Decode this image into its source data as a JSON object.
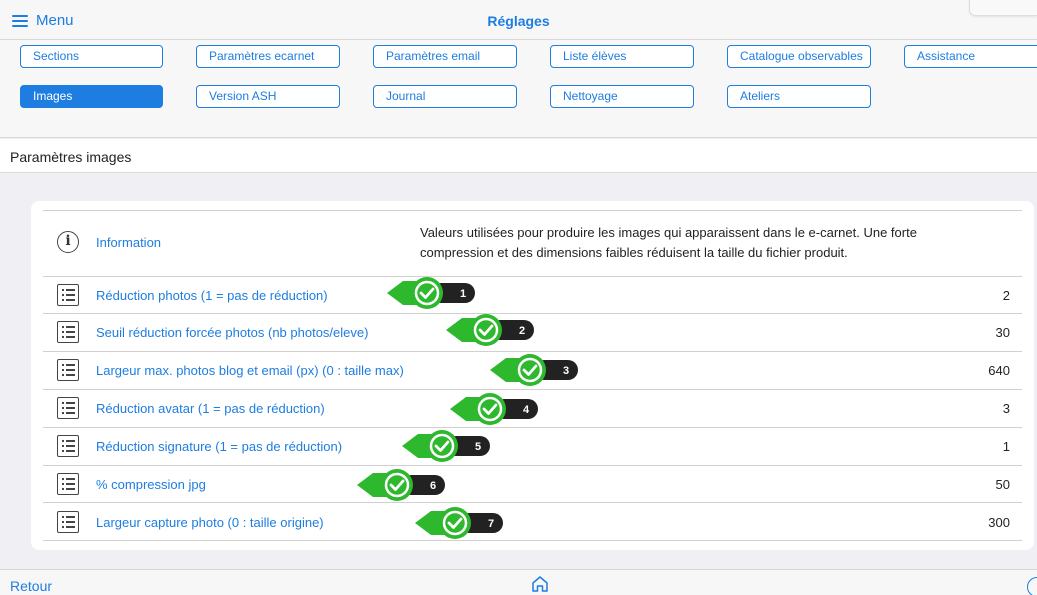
{
  "header": {
    "menu_label": "Menu",
    "title": "Réglages"
  },
  "tabs": [
    {
      "label": "Sections"
    },
    {
      "label": "Paramètres ecarnet"
    },
    {
      "label": "Paramètres email"
    },
    {
      "label": "Liste élèves"
    },
    {
      "label": "Catalogue observables"
    },
    {
      "label": "Assistance"
    },
    {
      "label": "Images",
      "active": true
    },
    {
      "label": "Version ASH"
    },
    {
      "label": "Journal"
    },
    {
      "label": "Nettoyage"
    },
    {
      "label": "Ateliers"
    }
  ],
  "section_title": "Paramètres images",
  "info": {
    "label": "Information",
    "description": "Valeurs utilisées pour produire les images qui apparaissent dans le e-carnet. Une forte compression et des dimensions faibles réduisent la taille du fichier produit."
  },
  "settings": [
    {
      "label": "Réduction photos (1 = pas de réduction)",
      "value": "2",
      "badge": "1"
    },
    {
      "label": "Seuil réduction forcée photos (nb photos/eleve)",
      "value": "30",
      "badge": "2"
    },
    {
      "label": "Largeur max. photos blog et email (px) (0 : taille max)",
      "value": "640",
      "badge": "3"
    },
    {
      "label": "Réduction avatar (1 = pas de réduction)",
      "value": "3",
      "badge": "4"
    },
    {
      "label": "Réduction signature (1 = pas de réduction)",
      "value": "1",
      "badge": "5"
    },
    {
      "label": "% compression jpg",
      "value": "50",
      "badge": "6"
    },
    {
      "label": "Largeur capture photo (0 : taille origine)",
      "value": "300",
      "badge": "7"
    }
  ],
  "footer": {
    "back_label": "Retour"
  },
  "colors": {
    "accent": "#1e7de0",
    "marker_green": "#2eb82e",
    "badge_dark": "#222222"
  },
  "icons": {
    "menu": "hamburger-icon",
    "info": "info-icon",
    "row": "list-icon",
    "marker": "checkmark-icon",
    "home": "home-icon",
    "help": "help-icon"
  }
}
